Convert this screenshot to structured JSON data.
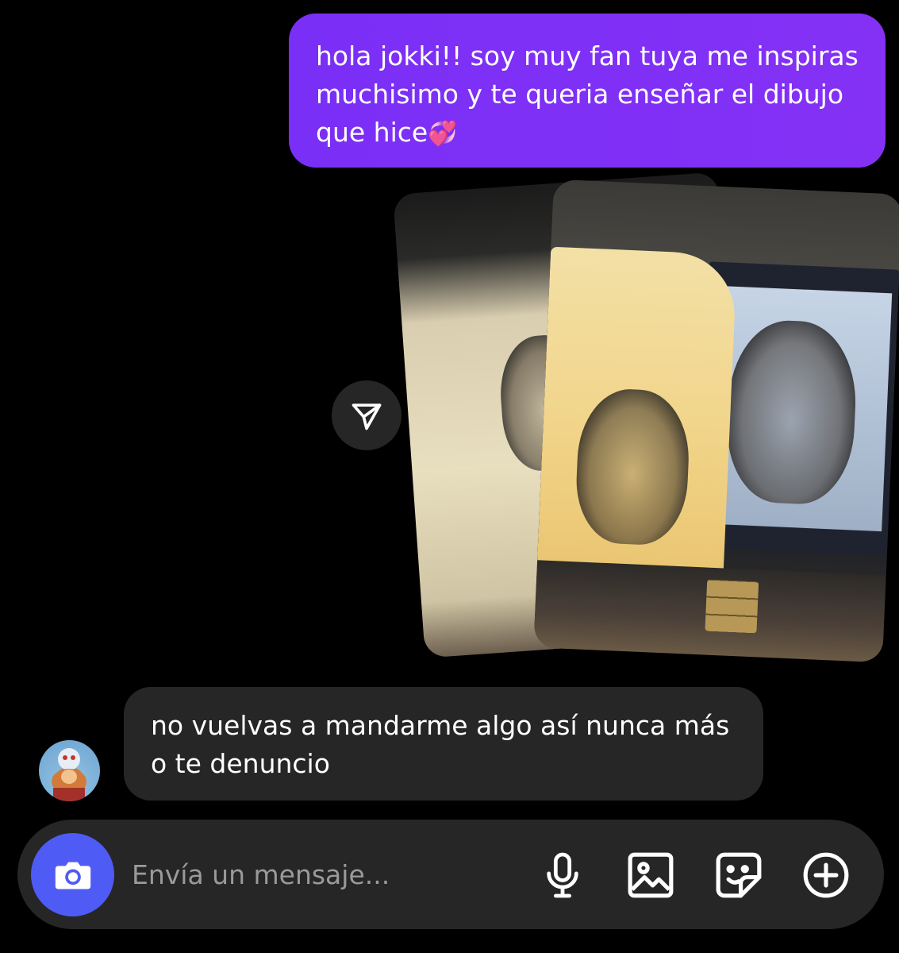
{
  "thread": {
    "sent_message": {
      "text": "hola jokki!! soy muy fan tuya me inspiras muchisimo y te queria enseñar el dibujo que hice",
      "emoji": "💞"
    },
    "received_message": {
      "text": "no vuelvas a mandarme algo así nunca más o te denuncio"
    }
  },
  "composer": {
    "placeholder": "Envía un mensaje..."
  },
  "icons": {
    "share": "paper-plane-icon",
    "camera": "camera-icon",
    "mic": "microphone-icon",
    "gallery": "image-icon",
    "sticker": "sticker-icon",
    "plus": "plus-circle-icon"
  },
  "colors": {
    "background": "#000000",
    "sent_bubble": "#7b2ff7",
    "received_bubble": "#262626",
    "composer_bg": "#262626",
    "camera_button": "#4f5bf5",
    "text": "#ffffff",
    "placeholder": "#9a9a9a"
  }
}
